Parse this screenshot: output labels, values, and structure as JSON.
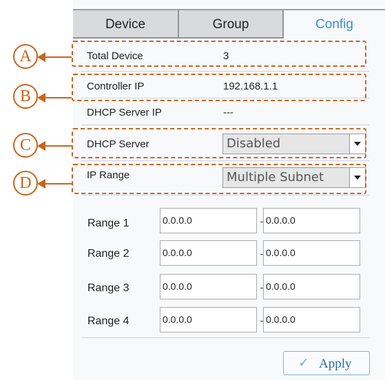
{
  "tabs": [
    {
      "label": "Device"
    },
    {
      "label": "Group"
    },
    {
      "label": "Config"
    }
  ],
  "info": {
    "total_device": {
      "label": "Total Device",
      "value": "3"
    },
    "controller_ip": {
      "label": "Controller IP",
      "value": "192.168.1.1"
    },
    "dhcp_server_ip": {
      "label": "DHCP Server IP",
      "value": "---"
    }
  },
  "dhcp_server": {
    "label": "DHCP Server",
    "selected": "Disabled"
  },
  "ip_range": {
    "label": "IP Range",
    "selected": "Multiple Subnet"
  },
  "ranges": [
    {
      "label": "Range 1",
      "start": "0.0.0.0",
      "end": "0.0.0.0"
    },
    {
      "label": "Range 2",
      "start": "0.0.0.0",
      "end": "0.0.0.0"
    },
    {
      "label": "Range 3",
      "start": "0.0.0.0",
      "end": "0.0.0.0"
    },
    {
      "label": "Range 4",
      "start": "0.0.0.0",
      "end": "0.0.0.0"
    }
  ],
  "apply_button": {
    "label": "Apply",
    "icon": "checkmark-icon"
  },
  "callouts": [
    "A",
    "B",
    "C",
    "D"
  ],
  "colors": {
    "accent": "#3b8ed4",
    "annotation": "#c8641c"
  }
}
